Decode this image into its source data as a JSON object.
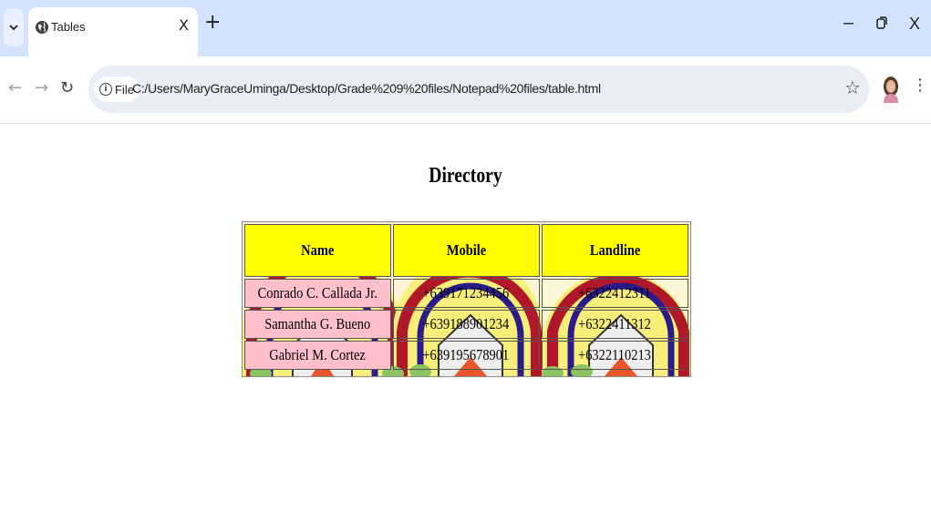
{
  "browser": {
    "tab_title": "Tables",
    "tab_close": "X",
    "new_tab": "+",
    "chip_label": "File",
    "url": "C:/Users/MaryGraceUminga/Desktop/Grade%209%20files/Notepad%20files/table.html",
    "window_controls": {
      "minimize": "–",
      "close": "X"
    }
  },
  "page": {
    "heading": "Directory",
    "table": {
      "headers": [
        "Name",
        "Mobile",
        "Landline"
      ],
      "rows": [
        [
          "Conrado C. Callada Jr.",
          "+639171234456",
          "+6322412311"
        ],
        [
          "Samantha G. Bueno",
          "+639188901234",
          "+6322411312"
        ],
        [
          "Gabriel M. Cortez",
          "+639195678901",
          "+6322110213"
        ]
      ]
    }
  },
  "colors": {
    "header_bg": "#ffff00",
    "name_cell_bg": "#ffc0cb",
    "tabstrip_bg": "#d3e3fd"
  }
}
